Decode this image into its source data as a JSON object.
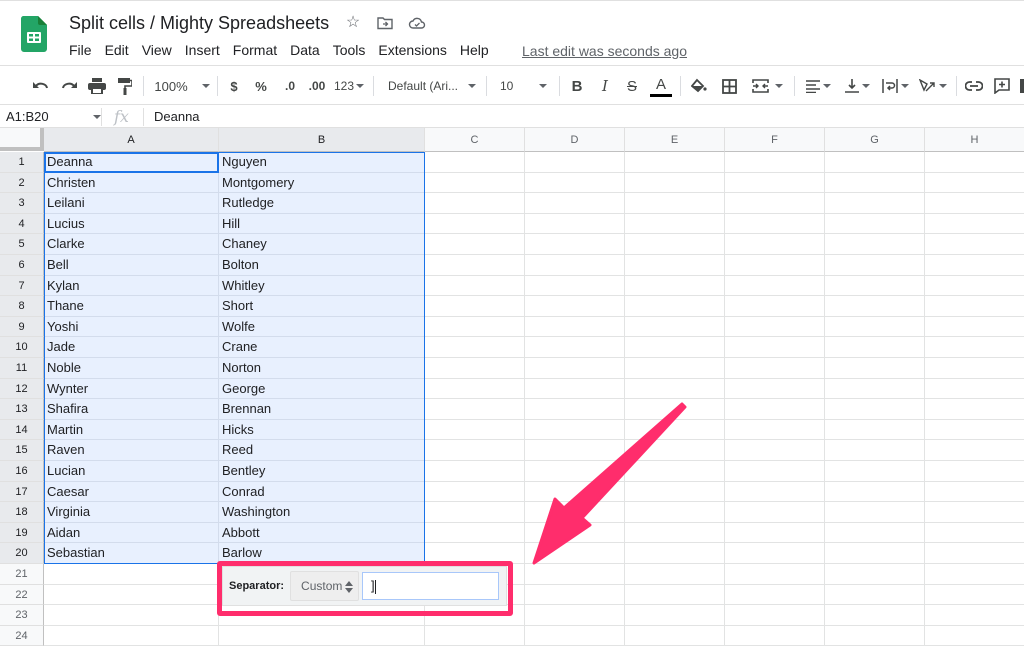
{
  "app": {
    "document_title": "Split cells / Mighty Spreadsheets",
    "title_icons": [
      "star-icon",
      "move-to-folder-icon",
      "cloud-saved-icon"
    ],
    "menu": [
      "File",
      "Edit",
      "View",
      "Insert",
      "Format",
      "Data",
      "Tools",
      "Extensions",
      "Help"
    ],
    "last_edit": "Last edit was seconds ago"
  },
  "toolbar": {
    "zoom": "100%",
    "currency": "$",
    "percent": "%",
    "decrease_decimal": ".0",
    "increase_decimal": ".00",
    "more_formats": "123",
    "font": "Default (Ari...",
    "font_size": "10",
    "bold": "B",
    "italic": "I",
    "strikethrough": "S",
    "text_color": "A",
    "text_color_value": "#000000"
  },
  "formula_bar": {
    "name_box": "A1:B20",
    "fx": "fx",
    "value": "Deanna"
  },
  "grid": {
    "columns": [
      "A",
      "B",
      "C",
      "D",
      "E",
      "F",
      "G",
      "H"
    ],
    "selected_range": "A1:B20",
    "active_cell": "A1",
    "rows": [
      {
        "n": "1",
        "a": "Deanna",
        "b": "Nguyen"
      },
      {
        "n": "2",
        "a": "Christen",
        "b": "Montgomery"
      },
      {
        "n": "3",
        "a": "Leilani",
        "b": "Rutledge"
      },
      {
        "n": "4",
        "a": "Lucius",
        "b": "Hill"
      },
      {
        "n": "5",
        "a": "Clarke",
        "b": "Chaney"
      },
      {
        "n": "6",
        "a": "Bell",
        "b": "Bolton"
      },
      {
        "n": "7",
        "a": "Kylan",
        "b": "Whitley"
      },
      {
        "n": "8",
        "a": "Thane",
        "b": "Short"
      },
      {
        "n": "9",
        "a": "Yoshi",
        "b": "Wolfe"
      },
      {
        "n": "10",
        "a": "Jade",
        "b": "Crane"
      },
      {
        "n": "11",
        "a": "Noble",
        "b": "Norton"
      },
      {
        "n": "12",
        "a": "Wynter",
        "b": "George"
      },
      {
        "n": "13",
        "a": "Shafira",
        "b": "Brennan"
      },
      {
        "n": "14",
        "a": "Martin",
        "b": "Hicks"
      },
      {
        "n": "15",
        "a": "Raven",
        "b": "Reed"
      },
      {
        "n": "16",
        "a": "Lucian",
        "b": "Bentley"
      },
      {
        "n": "17",
        "a": "Caesar",
        "b": "Conrad"
      },
      {
        "n": "18",
        "a": "Virginia",
        "b": "Washington"
      },
      {
        "n": "19",
        "a": "Aidan",
        "b": "Abbott"
      },
      {
        "n": "20",
        "a": "Sebastian",
        "b": "Barlow"
      },
      {
        "n": "21",
        "a": "",
        "b": ""
      },
      {
        "n": "22",
        "a": "",
        "b": ""
      },
      {
        "n": "23",
        "a": "",
        "b": ""
      },
      {
        "n": "24",
        "a": "",
        "b": ""
      }
    ]
  },
  "separator_popup": {
    "label": "Separator:",
    "selected_option": "Custom",
    "custom_value": "]"
  },
  "annotation": {
    "color": "#ff2d6c"
  },
  "colors": {
    "selection_fill": "#e8f0fe",
    "selection_border": "#1a73e8",
    "sheets_green": "#23a566"
  }
}
